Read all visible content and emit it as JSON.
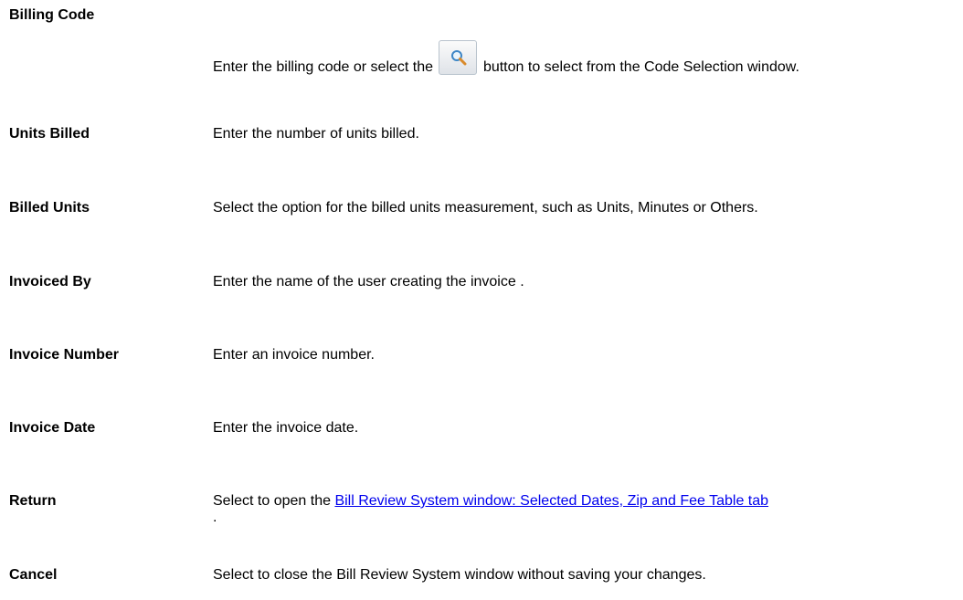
{
  "rows": [
    {
      "term": "Billing Code",
      "desc_before": "Enter the billing code or select the",
      "desc_after": "button to select from the Code Selection window.",
      "button_icon": "search-icon"
    },
    {
      "term": "Units Billed",
      "desc": "Enter the number of units billed."
    },
    {
      "term": "Billed Units",
      "desc": "Select the option for the billed units measurement, such as Units, Minutes or Others."
    },
    {
      "term": "Invoiced By",
      "desc": "Enter the name of the user creating the invoice ."
    },
    {
      "term": "Invoice Number",
      "desc": "Enter an invoice number."
    },
    {
      "term": "Invoice Date",
      "desc": "Enter the invoice date."
    },
    {
      "term": "Return",
      "desc_before": "Select to open the",
      "link": "Bill Review System window: Selected Dates, Zip and Fee Table tab",
      "desc_after": "."
    },
    {
      "term": "Cancel",
      "desc": "Select to close the Bill Review System window without saving your changes."
    }
  ],
  "colors": {
    "link": "#0000ee",
    "text": "#000000"
  }
}
